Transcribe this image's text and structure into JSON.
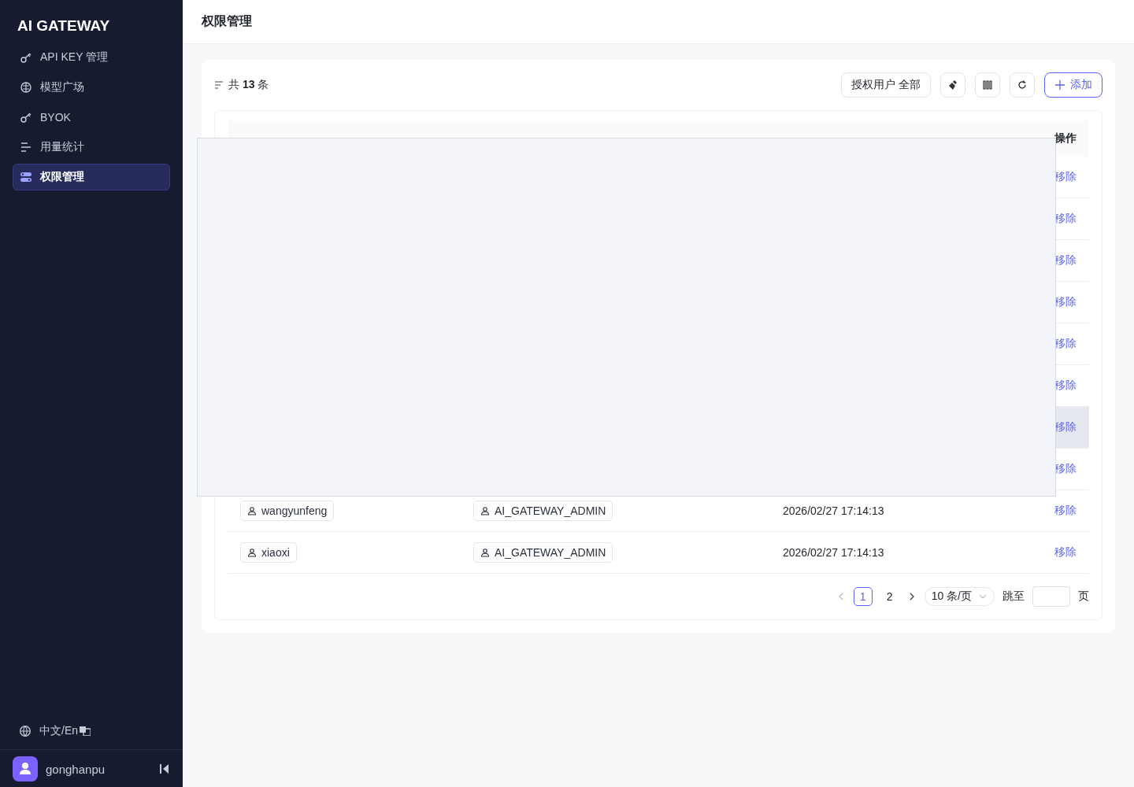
{
  "sidebar": {
    "logo": "AI GATEWAY",
    "items": [
      {
        "label": "API KEY 管理",
        "selected": false
      },
      {
        "label": "模型广场",
        "selected": false
      },
      {
        "label": "BYOK",
        "selected": false
      },
      {
        "label": "用量统计",
        "selected": false
      },
      {
        "label": "权限管理",
        "selected": true
      }
    ],
    "language": "中文/En",
    "user": "gonghanpu"
  },
  "page_title": "权限管理",
  "toolbar": {
    "total_prefix": "共",
    "total": "13",
    "total_suffix": "条",
    "filter": "授权用户 全部",
    "add": "添加"
  },
  "table": {
    "columns": [
      {
        "label": "操作"
      }
    ],
    "rows": [
      {
        "action": "移除",
        "highlighted": false
      },
      {
        "action": "移除",
        "highlighted": false
      },
      {
        "action": "移除",
        "highlighted": false
      },
      {
        "action": "移除",
        "highlighted": false
      },
      {
        "action": "移除",
        "highlighted": false
      },
      {
        "action": "移除",
        "highlighted": false
      },
      {
        "action": "移除",
        "highlighted": true
      },
      {
        "action": "移除",
        "highlighted": false
      },
      {
        "user": "wangyunfeng",
        "role": "AI_GATEWAY_ADMIN",
        "updated": "2026/02/27 17:14:13",
        "action": "移除",
        "highlighted": false
      },
      {
        "user": "xiaoxi",
        "role": "AI_GATEWAY_ADMIN",
        "updated": "2026/02/27 17:14:13",
        "action": "移除",
        "highlighted": false
      }
    ]
  },
  "pagination": {
    "pages": [
      {
        "label": "1",
        "selected": true
      },
      {
        "label": "2",
        "selected": false
      }
    ],
    "page_size": "10 条/页",
    "jump_label": "跳至",
    "page_suffix": "页"
  },
  "overlay": {
    "kind": "panel"
  }
}
